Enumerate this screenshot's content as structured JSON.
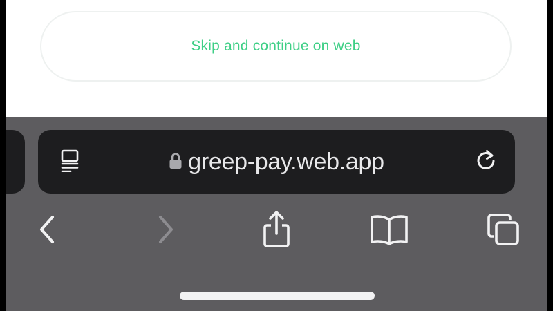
{
  "page": {
    "skip_button_label": "Skip and continue on web"
  },
  "browser": {
    "url": "greep-pay.web.app",
    "icons": {
      "reader": "reader-mode-icon",
      "lock": "lock-icon",
      "reload": "reload-icon",
      "back": "chevron-left-icon",
      "forward": "chevron-right-icon",
      "share": "share-icon",
      "bookmarks": "book-icon",
      "tabs": "tabs-icon"
    },
    "forward_enabled": false
  },
  "colors": {
    "accent": "#3ecf86",
    "chrome_bg": "#5d5c5f",
    "address_bar_bg": "#1d1d1f",
    "icon": "#f2f2f3",
    "icon_disabled": "#8d8c90"
  }
}
